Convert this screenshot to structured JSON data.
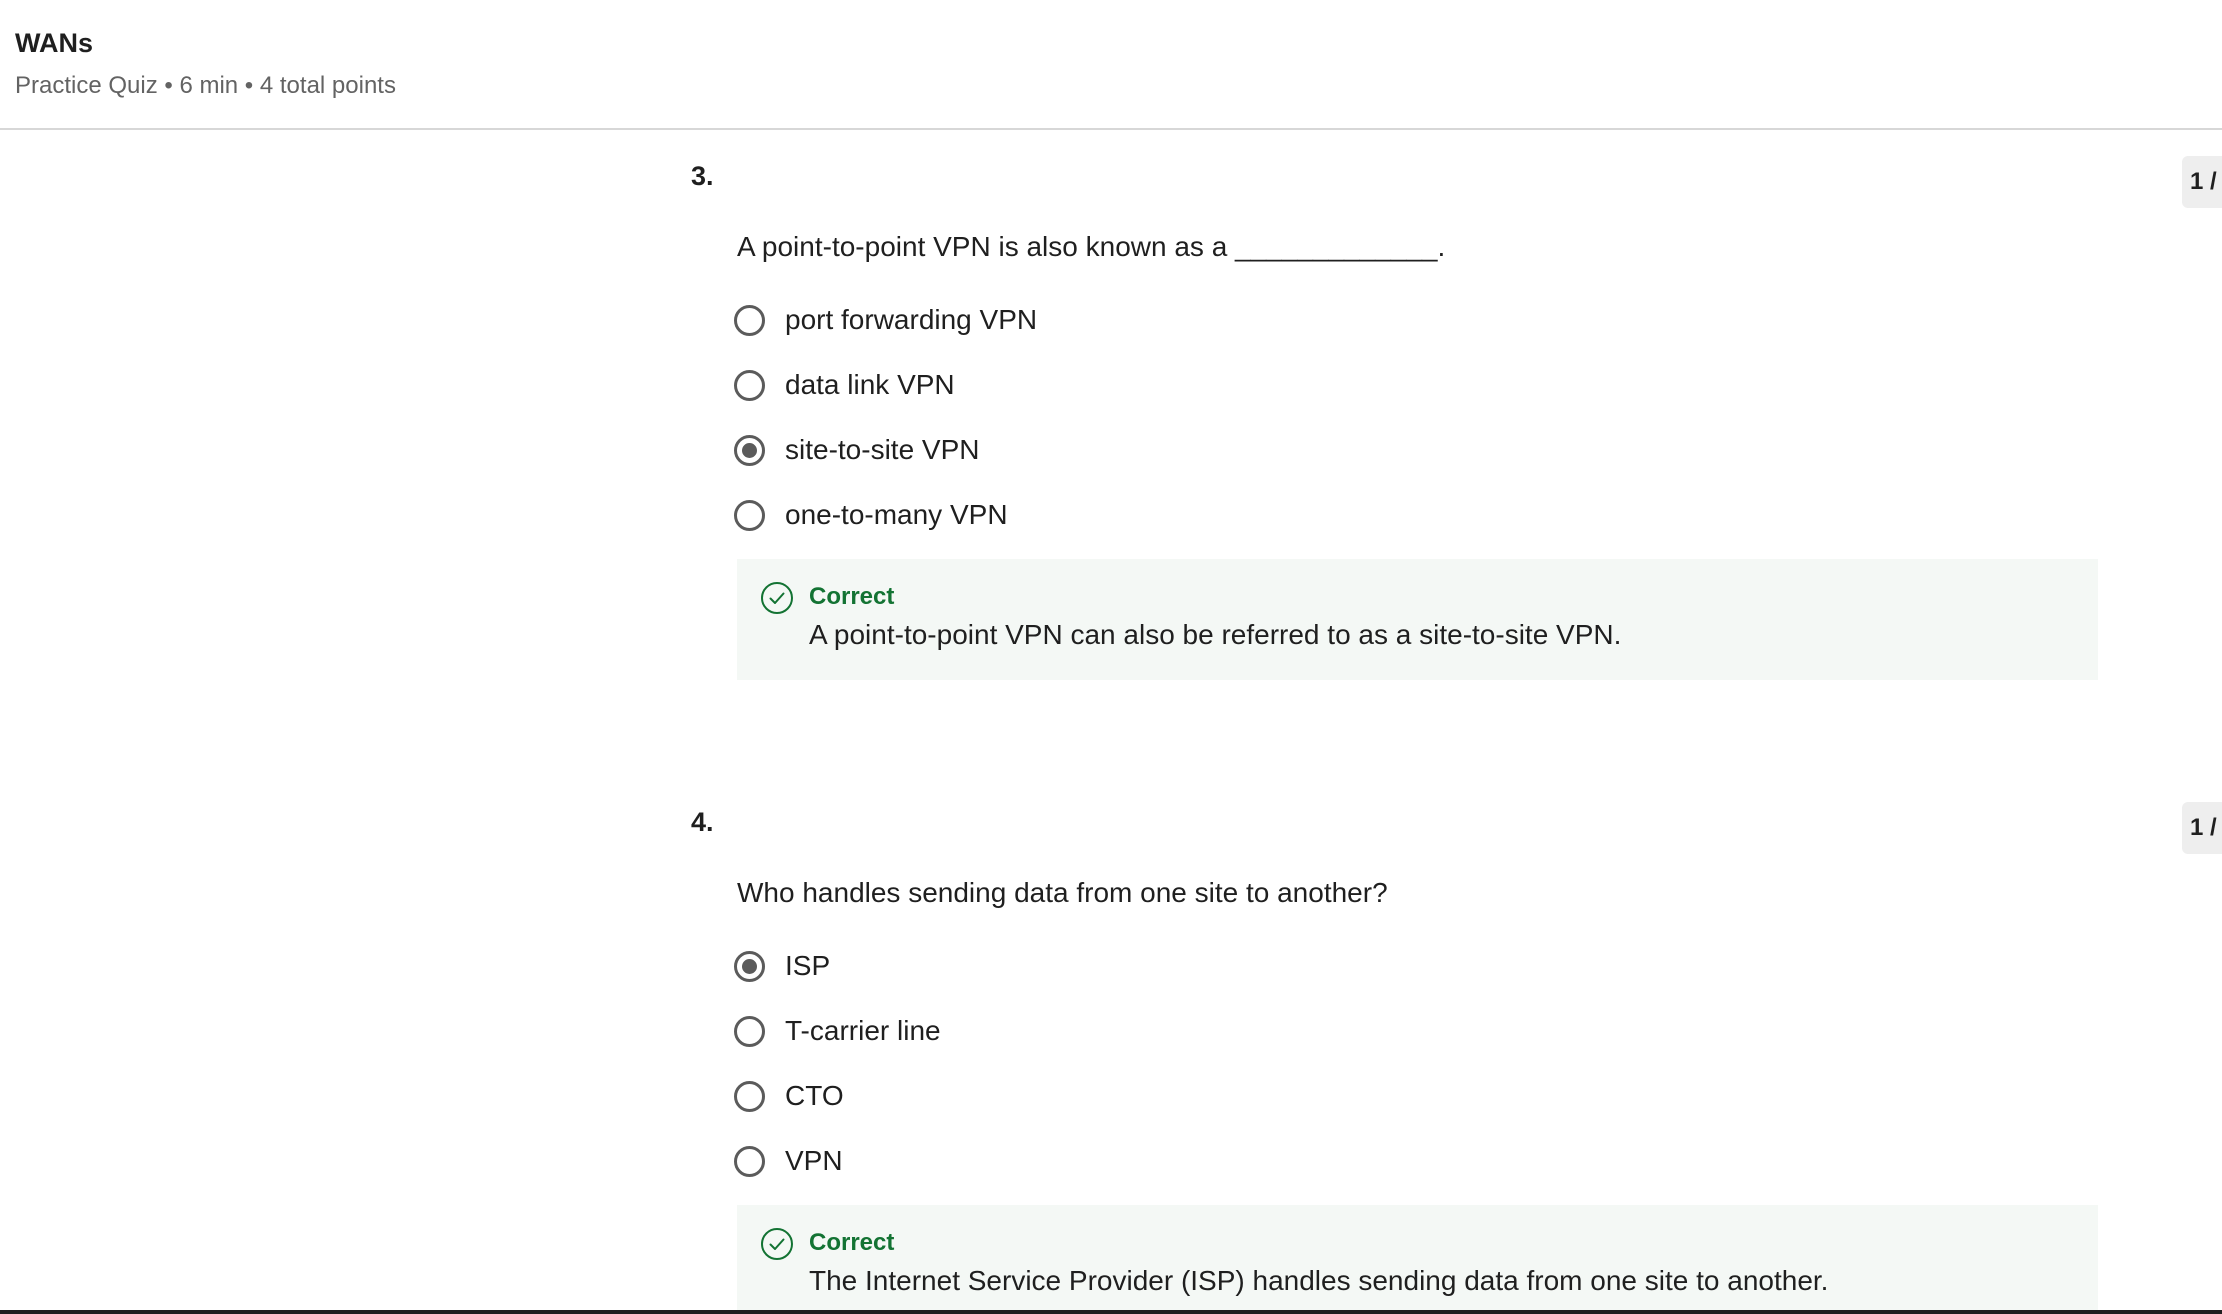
{
  "header": {
    "title": "WANs",
    "meta": "Practice Quiz • 6 min • 4 total points"
  },
  "questions": [
    {
      "number": "3.",
      "points": "1 /",
      "text": "A point-to-point VPN is also known as a _____________.",
      "options": [
        {
          "label": "port forwarding VPN",
          "selected": false
        },
        {
          "label": "data link VPN",
          "selected": false
        },
        {
          "label": "site-to-site VPN",
          "selected": true
        },
        {
          "label": "one-to-many VPN",
          "selected": false
        }
      ],
      "feedback": {
        "status": "Correct",
        "text": "A point-to-point VPN can also be referred to as a site-to-site VPN.",
        "icon": "check-circle-icon",
        "color": "#137333"
      }
    },
    {
      "number": "4.",
      "points": "1 /",
      "text": "Who handles sending data from one site to another?",
      "options": [
        {
          "label": "ISP",
          "selected": true
        },
        {
          "label": "T-carrier line",
          "selected": false
        },
        {
          "label": "CTO",
          "selected": false
        },
        {
          "label": "VPN",
          "selected": false
        }
      ],
      "feedback": {
        "status": "Correct",
        "text": "The Internet Service Provider (ISP) handles sending data from one site to another.",
        "icon": "check-circle-icon",
        "color": "#137333"
      }
    }
  ]
}
